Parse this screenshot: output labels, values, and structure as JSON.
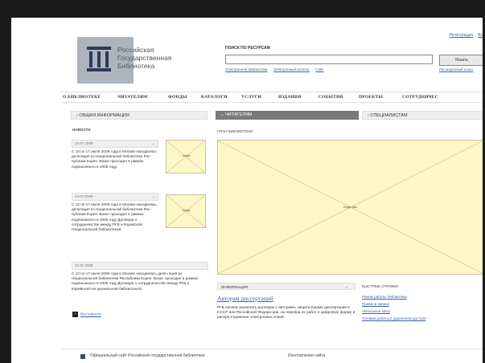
{
  "header": {
    "logo_lines": [
      "Российская",
      "Государственная",
      "Библиотека"
    ],
    "top_links": [
      "Регистрация",
      "Вх"
    ]
  },
  "search": {
    "title": "ПОИСК ПО РЕСУРСАМ",
    "placeholder": "",
    "button_label": "Искать",
    "options": [
      "Электронная библиотека",
      "Электронный каталог",
      "Сайт"
    ],
    "advanced_label": "Расширенный поиск"
  },
  "nav": {
    "items": [
      "О БИБЛИОТЕКЕ",
      "ЧИТАТЕЛЯМ",
      "ФОНДЫ",
      "КАТАЛОГИ",
      "УСЛУГИ",
      "ИЗДАНИЯ",
      "СОБЫТИЯ",
      "ПРОЕКТЫ",
      "СОТРУДНИЧЕС"
    ]
  },
  "sections": {
    "left_title": "ОБЩАЯ ИНФОРМАЦИЯ",
    "center_title": "ЧИТАТЕЛЯМ",
    "right_title": "СПЕЦИАЛИСТАМ"
  },
  "news": {
    "label": "НОВОСТИ",
    "items": [
      {
        "date": "24.07.2009",
        "text": "С 13 по 17 июля 2009 года в Москве находилась делегация из Национальной библиотеки Рес-публики Корея. Визит проходил в рамках подписанного в 2005 году."
      },
      {
        "date": "24.07.2009",
        "text": "С 13 по 17 июля 2009 года в Москве находилась делегация из Национальной библиотеки Рес-публики Корея. Визит проходил в рамках подписанного в 2005 году Договора о сотрудничестве между РГБ и Корейской Национальной библиотекой."
      },
      {
        "date": "24.07.2009",
        "text": "С 13 по 17 июля 2009 года в Москве находилась деле-гация из Национальной библиотеки Республики Корея. Визит проходил в рамках подписанного в 2005 году Договора о сотрудничестве между РГБ и Корейской На-циональной библиотекой."
      }
    ],
    "all_news": "Все новости"
  },
  "placeholders": {
    "image_label": "image",
    "plan_label": "ПЛАН БИБЛИОТЕКИ",
    "plan_image_label": "image-plan"
  },
  "info": {
    "bar_label": "ИНФОРМАЦИЯ",
    "title": "Авторам диссертаций",
    "text": "РГБ начала заключать договоры с авторами, защити-вшими диссертации в СССР или Российской Федера-ции, на перевод их работ в цифровую форму и распро-странение электронных копий."
  },
  "quick": {
    "label": "БЫСТРЫЕ СПРАВКИ",
    "links": [
      "Режим работы библиотеки",
      "Правила записи",
      "Читальные залы",
      "Условия работы в удаленном доступе"
    ]
  },
  "footer": {
    "left": "Официальный сайт Российской государственной библиотеки",
    "right": "Изготовление сайта"
  },
  "colors": {
    "link": "#3a5ea8",
    "placeholder_fill": "#fdf7c6",
    "frame": "#1a1a1a",
    "active_tab": "#7a7a7a"
  }
}
